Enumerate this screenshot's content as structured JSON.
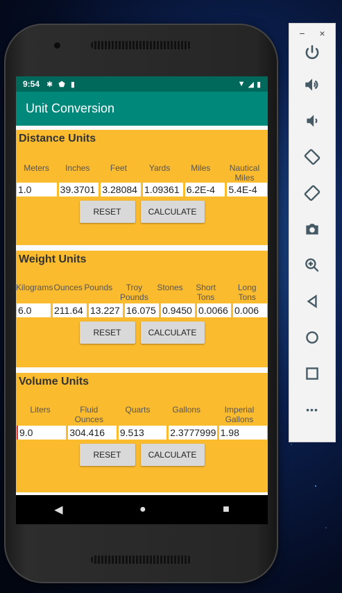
{
  "status_bar": {
    "time": "9:54"
  },
  "app_bar": {
    "title": "Unit Conversion"
  },
  "sections": [
    {
      "title": "Distance Units",
      "headers": [
        "Meters",
        "Inches",
        "Feet",
        "Yards",
        "Miles",
        "Nautical Miles"
      ],
      "values": [
        "1.0",
        "39.3701",
        "3.28084",
        "1.09361",
        "6.2E-4",
        "5.4E-4"
      ],
      "reset_label": "RESET",
      "calculate_label": "CALCULATE"
    },
    {
      "title": "Weight Units",
      "headers": [
        "Kilograms",
        "Ounces",
        "Pounds",
        "Troy Pounds",
        "Stones",
        "Short Tons",
        "Long Tons"
      ],
      "values": [
        "6.0",
        "211.64",
        "13.227",
        "16.075",
        "0.9450",
        "0.0066",
        "0.006"
      ],
      "reset_label": "RESET",
      "calculate_label": "CALCULATE"
    },
    {
      "title": "Volume Units",
      "headers": [
        "Liters",
        "Fluid Ounces",
        "Quarts",
        "Gallons",
        "Imperial Gallons"
      ],
      "values": [
        "9.0",
        "304.416",
        "9.513",
        "2.3777999",
        "1.98"
      ],
      "reset_label": "RESET",
      "calculate_label": "CALCULATE"
    }
  ],
  "emulator_toolbar": {
    "minimize": "−",
    "close": "×",
    "more": "•••"
  },
  "colors": {
    "status_bar": "#00695c",
    "app_bar": "#00897b",
    "section_bg": "#fbbb2e"
  }
}
